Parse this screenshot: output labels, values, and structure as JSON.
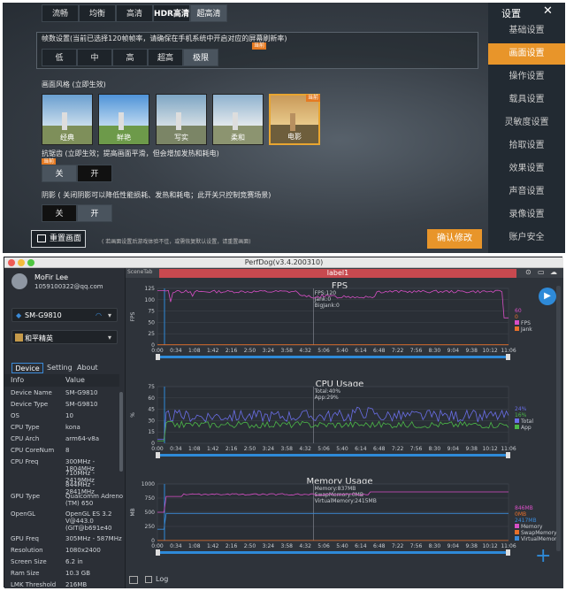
{
  "game": {
    "quality_tabs": [
      "流畅",
      "均衡",
      "高清",
      "HDR高清",
      "超高清"
    ],
    "quality_selected": "超高清",
    "fps_note": "帧数设置(当前已选择120帧帧率，请确保在手机系统中开启对应的屏幕刷新率)",
    "fps_badge": "当前",
    "fps_options": [
      "低",
      "中",
      "高",
      "超高",
      "极限"
    ],
    "style_title": "画面风格 (立即生效)",
    "styles": [
      "经典",
      "鲜艳",
      "写实",
      "柔和",
      "电影"
    ],
    "style_selected": "电影",
    "style_badge": "当前",
    "aa_title": "抗锯齿 (立即生效；提高画面平滑，但会增加发热和耗电)",
    "aa_badge": "当前",
    "aa_options": [
      "关",
      "开"
    ],
    "shadow_title": "阴影 ( 关闭阴影可以降低性能损耗、发热和耗电；此开关只控制竞赛场景)",
    "shadow_options": [
      "关",
      "开"
    ],
    "reset_label": "重置画面",
    "hint": "( 若画面设置后游戏体验不佳，或需恢复默认设置，请重置画面)",
    "confirm_label": "确认修改",
    "settings_title": "设置",
    "close_icon": "✕",
    "sidebar": [
      "基础设置",
      "画面设置",
      "操作设置",
      "载具设置",
      "灵敏度设置",
      "拾取设置",
      "效果设置",
      "声音设置",
      "录像设置",
      "账户安全"
    ],
    "sidebar_selected": "画面设置"
  },
  "perfdog": {
    "window_title": "PerfDog(v3.4.200310)",
    "user_name": "MoFir Lee",
    "user_email": "1059100322@qq.com",
    "device": "SM-G9810",
    "app": "和平精英",
    "tabs": [
      "Device",
      "Setting",
      "About"
    ],
    "table_headers": [
      "Info",
      "Value"
    ],
    "info": [
      [
        "Device Name",
        "SM-G9810"
      ],
      [
        "Device Type",
        "SM-G9810"
      ],
      [
        "OS",
        "10"
      ],
      [
        "CPU Type",
        "kona"
      ],
      [
        "CPU Arch",
        "arm64-v8a"
      ],
      [
        "CPU CoreNum",
        "8"
      ],
      [
        "CPU Freq",
        "300MHz - 1804MHz"
      ],
      [
        "",
        "710MHz - 2419MHz"
      ],
      [
        "",
        "844MHz - 2841MHz"
      ],
      [
        "GPU Type",
        "Qualcomm Adreno (TM) 650"
      ],
      [
        "OpenGL",
        "OpenGL ES 3.2 V@443.0 (GIT@b691e40"
      ],
      [
        "GPU Freq",
        "305MHz - 587MHz"
      ],
      [
        "Resolution",
        "1080x2400"
      ],
      [
        "Screen Size",
        "6.2 in"
      ],
      [
        "Ram Size",
        "10.3 GB"
      ],
      [
        "LMK Threshold",
        "216MB"
      ]
    ],
    "scenetab": "SceneTab",
    "label": "label1",
    "log_label": "Log",
    "x_ticks": [
      "0:00",
      "0:34",
      "1:08",
      "1:42",
      "2:16",
      "2:50",
      "3:24",
      "3:58",
      "4:32",
      "5:06",
      "5:40",
      "6:14",
      "6:48",
      "7:22",
      "7:56",
      "8:30",
      "9:04",
      "9:38",
      "10:12",
      "11:06"
    ],
    "colors": {
      "fps": "#d84fc6",
      "jank": "#e8702a",
      "total": "#6a6ee8",
      "app": "#4cb848",
      "memory": "#d84fc6",
      "swap": "#e8702a",
      "virtual": "#3a8ad8",
      "accent": "#2e8ad8"
    }
  },
  "chart_data": [
    {
      "type": "line",
      "title": "FPS",
      "ylabel": "FPS",
      "ylim": [
        0,
        125
      ],
      "yticks": [
        0,
        25,
        50,
        75,
        100,
        125
      ],
      "cursor_text": [
        "FPS:120",
        "Jank:0",
        "BigJank:0"
      ],
      "series": [
        {
          "name": "FPS",
          "current": "60"
        },
        {
          "name": "Jank",
          "current": "0"
        }
      ]
    },
    {
      "type": "line",
      "title": "CPU Usage",
      "ylabel": "%",
      "ylim": [
        0,
        75
      ],
      "yticks": [
        0,
        15,
        30,
        45,
        60,
        75
      ],
      "cursor_text": [
        "Total:40%",
        "App:29%"
      ],
      "series": [
        {
          "name": "Total",
          "current": "24%"
        },
        {
          "name": "App",
          "current": "16%"
        }
      ]
    },
    {
      "type": "line",
      "title": "Memory Usage",
      "ylabel": "MB",
      "ylim": [
        0,
        1000
      ],
      "yticks": [
        0,
        250,
        500,
        750,
        1000
      ],
      "cursor_text": [
        "Memory:837MB",
        "SwapMemory:0MB",
        "VirtualMemory:2415MB"
      ],
      "series": [
        {
          "name": "Memory",
          "current": "846MB"
        },
        {
          "name": "SwapMemory",
          "current": "0MB"
        },
        {
          "name": "VirtualMemory",
          "current": "2417MB"
        }
      ]
    }
  ]
}
